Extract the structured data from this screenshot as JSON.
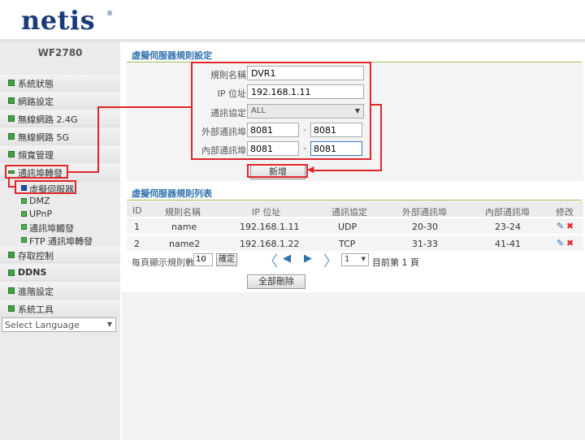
{
  "header": {
    "logo": "netis",
    "logo_mark": "®"
  },
  "sidebar": {
    "model": "WF2780",
    "items": [
      {
        "label": "系統狀態"
      },
      {
        "label": "網路設定"
      },
      {
        "label": "無線網路 2.4G"
      },
      {
        "label": "無線網路 5G"
      },
      {
        "label": "頻寬管理"
      },
      {
        "label": "通訊埠轉發"
      },
      {
        "label": "存取控制"
      },
      {
        "label": "DDNS"
      },
      {
        "label": "進階設定"
      },
      {
        "label": "系統工具"
      }
    ],
    "sub_items": [
      {
        "label": "虛擬伺服器"
      },
      {
        "label": "DMZ"
      },
      {
        "label": "UPnP"
      },
      {
        "label": "通訊埠觸發"
      },
      {
        "label": "FTP 通訊埠轉發"
      }
    ],
    "language": {
      "selected": "Select Language"
    }
  },
  "form": {
    "title": "虛擬伺服器規則設定",
    "rule_name_label": "規則名稱：",
    "rule_name_value": "DVR1",
    "ip_label": "IP 位址：",
    "ip_value": "192.168.1.11",
    "protocol_label": "通訊協定：",
    "protocol_value": "ALL",
    "ext_port_label": "外部通訊埠：",
    "ext_port_from": "8081",
    "ext_port_to": "8081",
    "int_port_label": "內部通訊埠：",
    "int_port_from": "8081",
    "int_port_to": "8081",
    "port_separator": "-",
    "add_button": "新增"
  },
  "rules_table": {
    "title": "虛擬伺服器規則列表",
    "columns": [
      "ID",
      "規則名稱",
      "IP 位址",
      "通訊協定",
      "外部通訊埠",
      "內部通訊埠",
      "修改"
    ],
    "rows": [
      {
        "id": "1",
        "name": "name",
        "ip": "192.168.1.11",
        "protocol": "UDP",
        "ext": "20-30",
        "int": "23-24"
      },
      {
        "id": "2",
        "name": "name2",
        "ip": "192.168.1.22",
        "protocol": "TCP",
        "ext": "31-33",
        "int": "41-41"
      }
    ],
    "per_page_label": "每頁顯示規則數",
    "per_page_value": "10",
    "confirm_button": "確定",
    "page_select": "1",
    "page_status": "目前第 1 頁",
    "delete_all_button": "全部刪除"
  },
  "colors": {
    "accent_red": "#e0262b",
    "title_blue": "#2e6fae",
    "nav_green": "#3fa142",
    "logo_blue": "#1a3a7a"
  },
  "icons": [
    "edit-icon",
    "delete-icon",
    "first-page-icon",
    "prev-page-icon",
    "next-page-icon",
    "last-page-icon",
    "dropdown-arrow-icon"
  ]
}
